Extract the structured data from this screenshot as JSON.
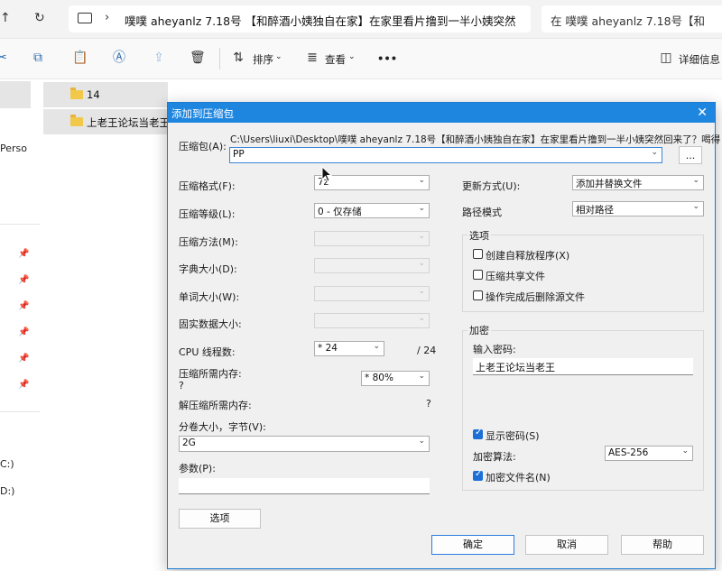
{
  "explorer": {
    "address_path": "噗噗 aheyanlz 7.18号 【和醉酒小姨独自在家】在家里看片撸到一半小姨突然",
    "search_placeholder": "在 噗噗 aheyanlz 7.18号【和",
    "toolbar": {
      "sort_label": "排序",
      "view_label": "查看",
      "more_label": "•••",
      "details_label": "详细信息"
    },
    "nav": {
      "person_text": "Perso",
      "drive_c": "C:)",
      "drive_d": "D:)"
    },
    "files": [
      {
        "name": "14"
      },
      {
        "name": "上老王论坛当老王"
      }
    ]
  },
  "dialog": {
    "title": "添加到压缩包",
    "archive_label": "压缩包(A):",
    "archive_path": "C:\\Users\\liuxi\\Desktop\\噗噗 aheyanlz 7.18号【和醉酒小姨独自在家】在家里看片撸到一半小姨突然回来了？喝得",
    "archive_name": "PP",
    "browse_label": "...",
    "format_label": "压缩格式(F):",
    "format_value": "7z",
    "level_label": "压缩等级(L):",
    "level_value": "0 - 仅存储",
    "method_label": "压缩方法(M):",
    "dict_label": "字典大小(D):",
    "word_label": "单词大小(W):",
    "solid_label": "固实数据大小:",
    "cpu_label": "CPU 线程数:",
    "cpu_value": "* 24",
    "cpu_total": "/ 24",
    "mem_label": "压缩所需内存:",
    "mem_question": "?",
    "mem_value": "* 80%",
    "decomp_label": "解压缩所需内存:",
    "decomp_value": "?",
    "split_label": "分卷大小，字节(V):",
    "split_value": "2G",
    "params_label": "参数(P):",
    "options_button": "选项",
    "update_label": "更新方式(U):",
    "update_value": "添加并替换文件",
    "path_label": "路径模式",
    "path_value": "相对路径",
    "options_group": "选项",
    "opt_sfx": "创建自释放程序(X)",
    "opt_shared": "压缩共享文件",
    "opt_delete": "操作完成后删除源文件",
    "encrypt_group": "加密",
    "password_label": "输入密码:",
    "password_value": "上老王论坛当老王",
    "show_password": "显示密码(S)",
    "enc_method_label": "加密算法:",
    "enc_method_value": "AES-256",
    "enc_names": "加密文件名(N)",
    "ok_button": "确定",
    "cancel_button": "取消",
    "help_button": "帮助"
  }
}
